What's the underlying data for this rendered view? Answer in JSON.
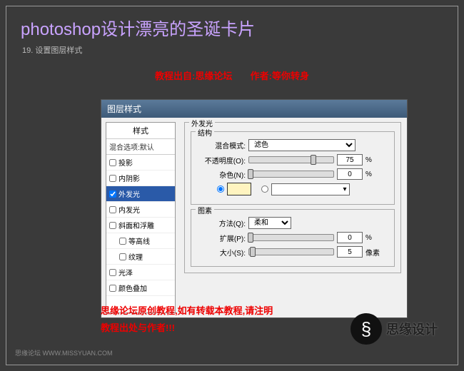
{
  "page": {
    "title": "photoshop设计漂亮的圣诞卡片",
    "step": "19. 设置图层样式",
    "credit_left": "教程出自:思缘论坛",
    "credit_right": "作者:等你转身"
  },
  "dialog": {
    "title": "图层样式",
    "sidebar": {
      "header": "样式",
      "blend": "混合选项:默认",
      "items": [
        {
          "label": "投影",
          "checked": false
        },
        {
          "label": "内阴影",
          "checked": false
        },
        {
          "label": "外发光",
          "checked": true,
          "selected": true
        },
        {
          "label": "内发光",
          "checked": false
        },
        {
          "label": "斜面和浮雕",
          "checked": false
        },
        {
          "label": "等高线",
          "checked": false,
          "indent": true
        },
        {
          "label": "纹理",
          "checked": false,
          "indent": true
        },
        {
          "label": "光泽",
          "checked": false
        },
        {
          "label": "颜色叠加",
          "checked": false
        }
      ]
    },
    "outer_glow": {
      "title": "外发光",
      "structure": {
        "title": "结构",
        "blend_mode_label": "混合模式:",
        "blend_mode_value": "滤色",
        "opacity_label": "不透明度(O):",
        "opacity_value": "75",
        "opacity_unit": "%",
        "noise_label": "杂色(N):",
        "noise_value": "0",
        "noise_unit": "%",
        "color_swatch": "#fff4c0"
      },
      "elements": {
        "title": "图素",
        "technique_label": "方法(Q):",
        "technique_value": "柔和",
        "spread_label": "扩展(P):",
        "spread_value": "0",
        "spread_unit": "%",
        "size_label": "大小(S):",
        "size_value": "5",
        "size_unit": "像素"
      }
    }
  },
  "footer": {
    "line1": "思缘论坛原创教程,如有转载本教程,请注明",
    "line2": "教程出处与作者!!!"
  },
  "logo": {
    "text": "思缘设计"
  },
  "bottom": {
    "site": "思缘论坛   WWW.MISSYUAN.COM"
  }
}
